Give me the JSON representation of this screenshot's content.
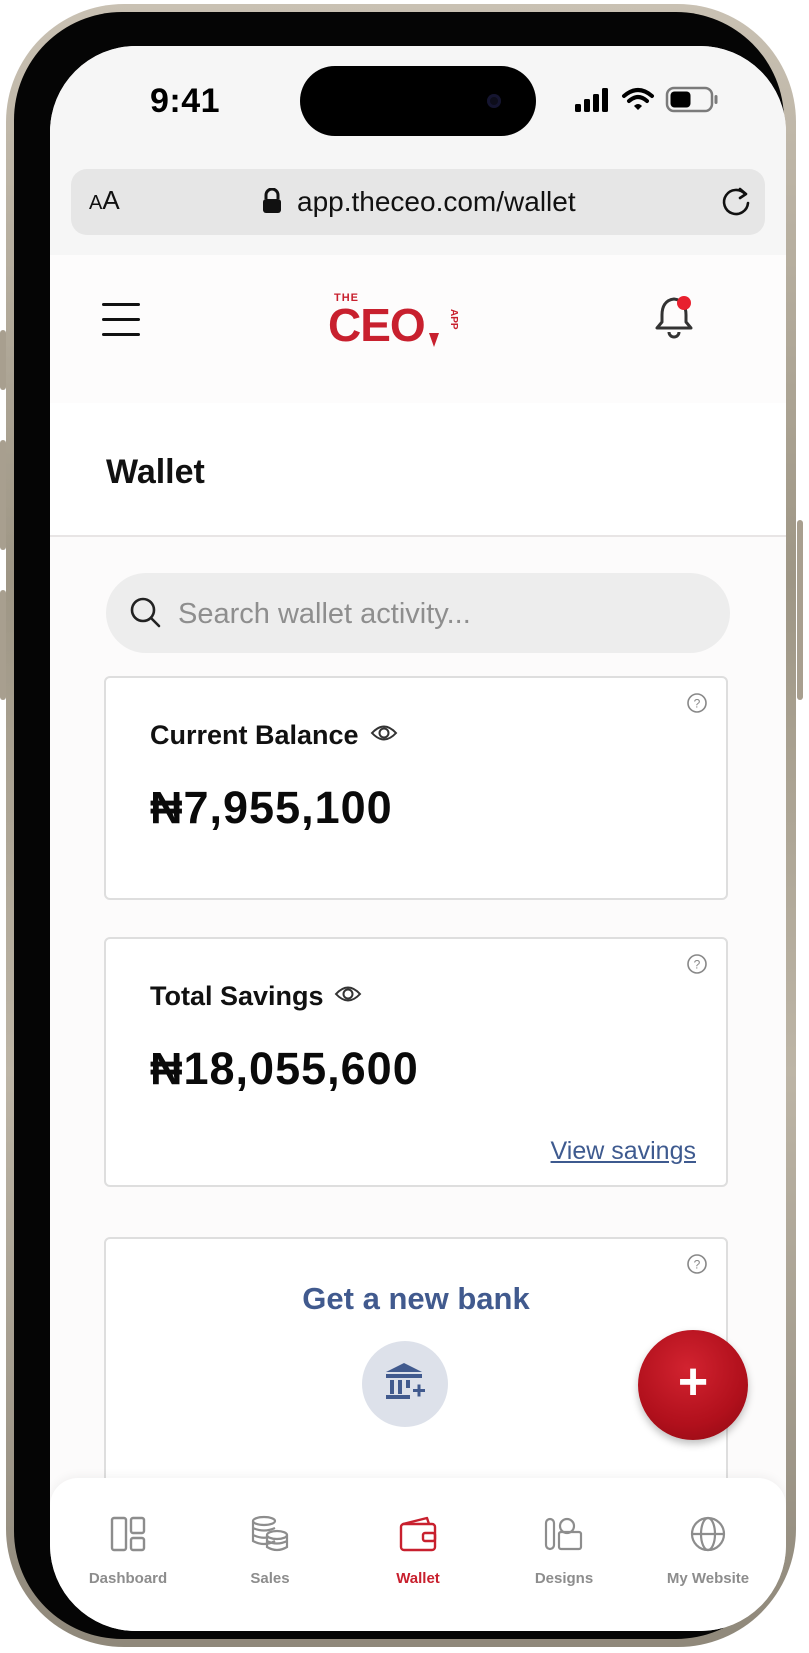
{
  "status_bar": {
    "time": "9:41"
  },
  "browser": {
    "text_size_label": "AA",
    "url": "app.theceo.com/wallet"
  },
  "header": {
    "logo": {
      "small_text": "THE",
      "main_text": "CEO",
      "side_text": "APP",
      "brand_color": "#c8202e"
    },
    "notification_dot_color": "#e8202e"
  },
  "page": {
    "title": "Wallet"
  },
  "search": {
    "placeholder": "Search wallet activity...",
    "value": ""
  },
  "cards": {
    "current_balance": {
      "label": "Current Balance",
      "amount": "₦7,955,100"
    },
    "total_savings": {
      "label": "Total Savings",
      "amount": "₦18,055,600",
      "link": "View savings"
    },
    "new_bank": {
      "title": "Get a new bank"
    }
  },
  "fab": {
    "label": "+"
  },
  "tabs": [
    {
      "label": "Dashboard",
      "icon": "dashboard-icon",
      "active": false
    },
    {
      "label": "Sales",
      "icon": "coins-icon",
      "active": false
    },
    {
      "label": "Wallet",
      "icon": "wallet-icon",
      "active": true
    },
    {
      "label": "Designs",
      "icon": "designs-icon",
      "active": false
    },
    {
      "label": "My Website",
      "icon": "globe-icon",
      "active": false
    }
  ],
  "colors": {
    "accent": "#c8202e",
    "link": "#3e5a8f",
    "bank_title": "#415a8e"
  }
}
